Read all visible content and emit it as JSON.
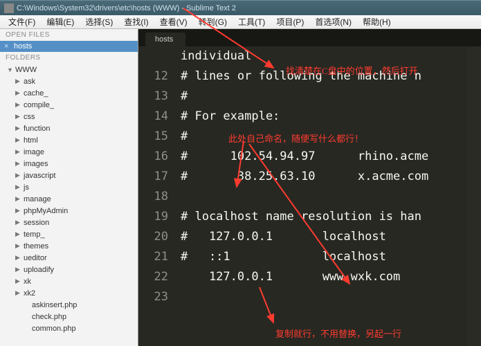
{
  "titlebar": {
    "path": "C:\\Windows\\System32\\drivers\\etc\\hosts (WWW) - Sublime Text 2"
  },
  "menubar": {
    "items": [
      "文件(F)",
      "编辑(E)",
      "选择(S)",
      "查找(I)",
      "查看(V)",
      "转到(G)",
      "工具(T)",
      "项目(P)",
      "首选项(N)",
      "帮助(H)"
    ]
  },
  "sidebar": {
    "open_files_label": "OPEN FILES",
    "open_file": "hosts",
    "folders_label": "FOLDERS",
    "root": "WWW",
    "folders": [
      "ask",
      "cache_",
      "compile_",
      "css",
      "function",
      "html",
      "image",
      "images",
      "javascript",
      "js",
      "manage",
      "phpMyAdmin",
      "session",
      "temp_",
      "themes",
      "ueditor",
      "uploadify",
      "xk",
      "xk2"
    ],
    "files": [
      "askinsert.php",
      "check.php",
      "common.php"
    ]
  },
  "editor": {
    "tab_label": "hosts",
    "first_visible_line": 11,
    "lines": [
      "individual",
      "# lines or following the machine n",
      "#",
      "# For example:",
      "#",
      "#      102.54.94.97      rhino.acme",
      "#       38.25.63.10      x.acme.com",
      "",
      "# localhost name resolution is han",
      "#   127.0.0.1       localhost",
      "#   ::1             localhost",
      "    127.0.0.1       www.wxk.com",
      ""
    ]
  },
  "annotations": {
    "a1": "找清楚在C盘中的位置，然后打开",
    "a2": "此处自己命名，随便写什么都行！",
    "a3": "复制就行，不用替换，另起一行"
  }
}
